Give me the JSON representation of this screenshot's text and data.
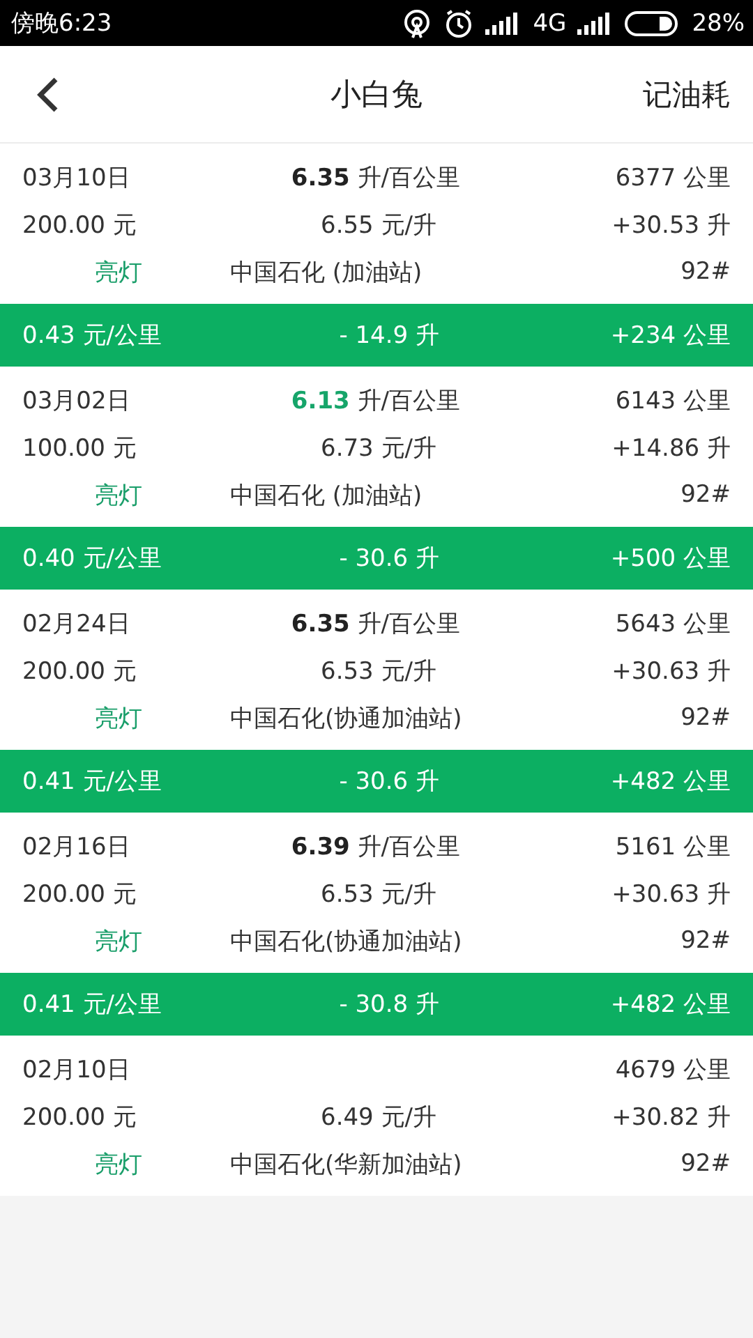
{
  "status_bar": {
    "time": "傍晚6:23",
    "network": "4G",
    "battery": "28%"
  },
  "header": {
    "title": "小白兔",
    "action": "记油耗"
  },
  "records": [
    {
      "date": "03月10日",
      "efficiency": {
        "value": "6.35",
        "unit": "升/百公里",
        "highlight": false
      },
      "odometer": "6377 公里",
      "amount": "200.00 元",
      "price": "6.55 元/升",
      "added": "+30.53 升",
      "light": "亮灯",
      "station": "中国石化 (加油站)",
      "grade": "92#",
      "interval": {
        "cost": "0.43 元/公里",
        "fuel": "- 14.9 升",
        "distance": "+234 公里"
      }
    },
    {
      "date": "03月02日",
      "efficiency": {
        "value": "6.13",
        "unit": "升/百公里",
        "highlight": true
      },
      "odometer": "6143 公里",
      "amount": "100.00 元",
      "price": "6.73 元/升",
      "added": "+14.86 升",
      "light": "亮灯",
      "station": "中国石化 (加油站)",
      "grade": "92#",
      "interval": {
        "cost": "0.40 元/公里",
        "fuel": "- 30.6 升",
        "distance": "+500 公里"
      }
    },
    {
      "date": "02月24日",
      "efficiency": {
        "value": "6.35",
        "unit": "升/百公里",
        "highlight": false
      },
      "odometer": "5643 公里",
      "amount": "200.00 元",
      "price": "6.53 元/升",
      "added": "+30.63 升",
      "light": "亮灯",
      "station": "中国石化(协通加油站)",
      "grade": "92#",
      "interval": {
        "cost": "0.41 元/公里",
        "fuel": "- 30.6 升",
        "distance": "+482 公里"
      }
    },
    {
      "date": "02月16日",
      "efficiency": {
        "value": "6.39",
        "unit": "升/百公里",
        "highlight": false
      },
      "odometer": "5161 公里",
      "amount": "200.00 元",
      "price": "6.53 元/升",
      "added": "+30.63 升",
      "light": "亮灯",
      "station": "中国石化(协通加油站)",
      "grade": "92#",
      "interval": {
        "cost": "0.41 元/公里",
        "fuel": "- 30.8 升",
        "distance": "+482 公里"
      }
    },
    {
      "date": "02月10日",
      "odometer": "4679 公里",
      "amount": "200.00 元",
      "price": "6.49 元/升",
      "added": "+30.82 升",
      "light": "亮灯",
      "station": "中国石化(华新加油站)",
      "grade": "92#"
    }
  ]
}
